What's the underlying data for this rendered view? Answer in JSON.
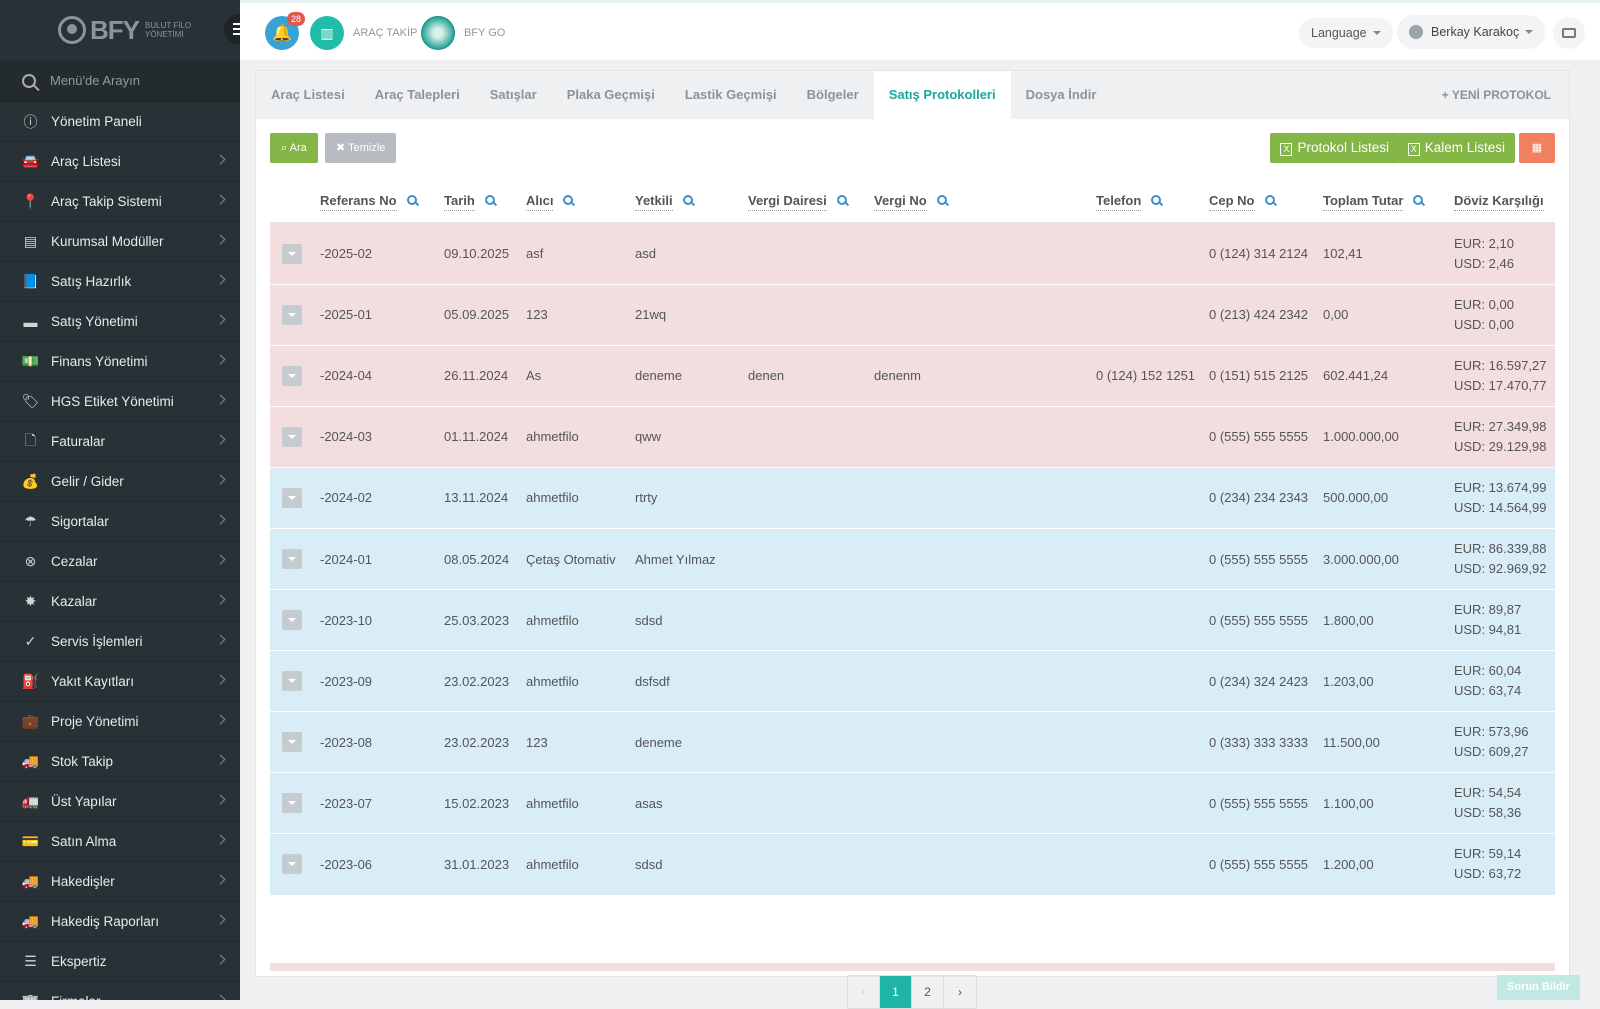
{
  "brand": {
    "name": "BFY",
    "sub1": "BULUT FİLO",
    "sub2": "YÖNETİMİ"
  },
  "sidebar": {
    "search_placeholder": "Menü'de Arayın",
    "items": [
      {
        "label": "Yönetim Paneli",
        "icon": "info-icon",
        "glyph": "ⓘ",
        "chev": false
      },
      {
        "label": "Araç Listesi",
        "icon": "car-icon",
        "glyph": "🚘",
        "chev": true
      },
      {
        "label": "Araç Takip Sistemi",
        "icon": "map-pin-icon",
        "glyph": "📍",
        "chev": true
      },
      {
        "label": "Kurumsal Modüller",
        "icon": "server-icon",
        "glyph": "▤",
        "chev": true
      },
      {
        "label": "Satış Hazırlık",
        "icon": "book-icon",
        "glyph": "📘",
        "chev": true
      },
      {
        "label": "Satış Yönetimi",
        "icon": "card-icon",
        "glyph": "▬",
        "chev": true
      },
      {
        "label": "Finans Yönetimi",
        "icon": "money-icon",
        "glyph": "💵",
        "chev": true
      },
      {
        "label": "HGS Etiket Yönetimi",
        "icon": "tag-icon",
        "glyph": "🏷",
        "chev": true
      },
      {
        "label": "Faturalar",
        "icon": "file-icon",
        "glyph": "🗋",
        "chev": true
      },
      {
        "label": "Gelir / Gider",
        "icon": "cash-icon",
        "glyph": "💰",
        "chev": true
      },
      {
        "label": "Sigortalar",
        "icon": "umbrella-icon",
        "glyph": "☂",
        "chev": true
      },
      {
        "label": "Cezalar",
        "icon": "close-circle-icon",
        "glyph": "⊗",
        "chev": true
      },
      {
        "label": "Kazalar",
        "icon": "crash-icon",
        "glyph": "✸",
        "chev": true
      },
      {
        "label": "Servis İşlemleri",
        "icon": "check-circle-icon",
        "glyph": "✓",
        "chev": true
      },
      {
        "label": "Yakıt Kayıtları",
        "icon": "fuel-icon",
        "glyph": "⛽",
        "chev": true
      },
      {
        "label": "Proje Yönetimi",
        "icon": "briefcase-icon",
        "glyph": "💼",
        "chev": true
      },
      {
        "label": "Stok Takip",
        "icon": "truck-icon",
        "glyph": "🚚",
        "chev": true
      },
      {
        "label": "Üst Yapılar",
        "icon": "truck-icon",
        "glyph": "🚛",
        "chev": true
      },
      {
        "label": "Satın Alma",
        "icon": "credit-card-icon",
        "glyph": "💳",
        "chev": true
      },
      {
        "label": "Hakedişler",
        "icon": "truck-icon",
        "glyph": "🚚",
        "chev": true
      },
      {
        "label": "Hakediş Raporları",
        "icon": "truck-icon",
        "glyph": "🚚",
        "chev": true
      },
      {
        "label": "Ekspertiz",
        "icon": "list-icon",
        "glyph": "☰",
        "chev": true
      },
      {
        "label": "Firmalar",
        "icon": "building-icon",
        "glyph": "🏢",
        "chev": true
      }
    ]
  },
  "topbar": {
    "notification_count": "28",
    "arac_takip": "ARAÇ TAKİP",
    "bfy_go": "BFY GO",
    "language": "Language",
    "user_name": "Berkay Karakoç"
  },
  "tabs": [
    {
      "label": "Araç Listesi",
      "active": false
    },
    {
      "label": "Araç Talepleri",
      "active": false
    },
    {
      "label": "Satışlar",
      "active": false
    },
    {
      "label": "Plaka Geçmişi",
      "active": false
    },
    {
      "label": "Lastik Geçmişi",
      "active": false
    },
    {
      "label": "Bölgeler",
      "active": false
    },
    {
      "label": "Satış Protokolleri",
      "active": true
    },
    {
      "label": "Dosya İndir",
      "active": false
    }
  ],
  "new_protocol": "YENİ PROTOKOL",
  "toolbar": {
    "search": "Ara",
    "clear": "Temizle",
    "protocol_list": "Protokol Listesi",
    "item_list": "Kalem Listesi"
  },
  "table": {
    "columns": [
      "Referans No",
      "Tarih",
      "Alıcı",
      "Yetkili",
      "Vergi Dairesi",
      "Vergi No",
      "Telefon",
      "Cep No",
      "Toplam Tutar",
      "Döviz Karşılığı"
    ],
    "rows": [
      {
        "status": "pink",
        "ref": "-2025-02",
        "date": "09.10.2025",
        "buyer": "asf",
        "auth": "asd",
        "taxoffice": "",
        "taxno": "",
        "phone": "",
        "mobile": "0 (124) 314 2124",
        "total": "102,41",
        "eur": "EUR: 2,10",
        "usd": "USD: 2,46"
      },
      {
        "status": "pink",
        "ref": "-2025-01",
        "date": "05.09.2025",
        "buyer": "123",
        "auth": "21wq",
        "taxoffice": "",
        "taxno": "",
        "phone": "",
        "mobile": "0 (213) 424 2342",
        "total": "0,00",
        "eur": "EUR: 0,00",
        "usd": "USD: 0,00"
      },
      {
        "status": "pink",
        "ref": "-2024-04",
        "date": "26.11.2024",
        "buyer": "As",
        "auth": "deneme",
        "taxoffice": "denen",
        "taxno": "denenm",
        "phone": "0 (124) 152 1251",
        "mobile": "0 (151) 515 2125",
        "total": "602.441,24",
        "eur": "EUR: 16.597,27",
        "usd": "USD: 17.470,77"
      },
      {
        "status": "pink",
        "ref": "-2024-03",
        "date": "01.11.2024",
        "buyer": "ahmetfilo",
        "auth": "qww",
        "taxoffice": "",
        "taxno": "",
        "phone": "",
        "mobile": "0 (555) 555 5555",
        "total": "1.000.000,00",
        "eur": "EUR: 27.349,98",
        "usd": "USD: 29.129,98"
      },
      {
        "status": "blue",
        "ref": "-2024-02",
        "date": "13.11.2024",
        "buyer": "ahmetfilo",
        "auth": "rtrty",
        "taxoffice": "",
        "taxno": "",
        "phone": "",
        "mobile": "0 (234) 234 2343",
        "total": "500.000,00",
        "eur": "EUR: 13.674,99",
        "usd": "USD: 14.564,99"
      },
      {
        "status": "blue",
        "ref": "-2024-01",
        "date": "08.05.2024",
        "buyer": "Çetaş Otomativ",
        "auth": "Ahmet Yılmaz",
        "taxoffice": "",
        "taxno": "",
        "phone": "",
        "mobile": "0 (555) 555 5555",
        "total": "3.000.000,00",
        "eur": "EUR: 86.339,88",
        "usd": "USD: 92.969,92"
      },
      {
        "status": "blue",
        "ref": "-2023-10",
        "date": "25.03.2023",
        "buyer": "ahmetfilo",
        "auth": "sdsd",
        "taxoffice": "",
        "taxno": "",
        "phone": "",
        "mobile": "0 (555) 555 5555",
        "total": "1.800,00",
        "eur": "EUR: 89,87",
        "usd": "USD: 94,81"
      },
      {
        "status": "blue",
        "ref": "-2023-09",
        "date": "23.02.2023",
        "buyer": "ahmetfilo",
        "auth": "dsfsdf",
        "taxoffice": "",
        "taxno": "",
        "phone": "",
        "mobile": "0 (234) 324 2423",
        "total": "1.203,00",
        "eur": "EUR: 60,04",
        "usd": "USD: 63,74"
      },
      {
        "status": "blue",
        "ref": "-2023-08",
        "date": "23.02.2023",
        "buyer": "123",
        "auth": "deneme",
        "taxoffice": "",
        "taxno": "",
        "phone": "",
        "mobile": "0 (333) 333 3333",
        "total": "11.500,00",
        "eur": "EUR: 573,96",
        "usd": "USD: 609,27"
      },
      {
        "status": "blue",
        "ref": "-2023-07",
        "date": "15.02.2023",
        "buyer": "ahmetfilo",
        "auth": "asas",
        "taxoffice": "",
        "taxno": "",
        "phone": "",
        "mobile": "0 (555) 555 5555",
        "total": "1.100,00",
        "eur": "EUR: 54,54",
        "usd": "USD: 58,36"
      },
      {
        "status": "blue",
        "ref": "-2023-06",
        "date": "31.01.2023",
        "buyer": "ahmetfilo",
        "auth": "sdsd",
        "taxoffice": "",
        "taxno": "",
        "phone": "",
        "mobile": "0 (555) 555 5555",
        "total": "1.200,00",
        "eur": "EUR: 59,14",
        "usd": "USD: 63,72"
      }
    ]
  },
  "pagination": {
    "prev": "‹",
    "pages": [
      "1",
      "2"
    ],
    "current": "1",
    "next": "›"
  },
  "report_issue": "Sorun Bildir",
  "colors": {
    "accent": "#1fb5a5",
    "success": "#84b547",
    "warning": "#f2825f",
    "sidebar": "#283135",
    "row_pink": "#f2dede",
    "row_blue": "#d9edf7"
  }
}
